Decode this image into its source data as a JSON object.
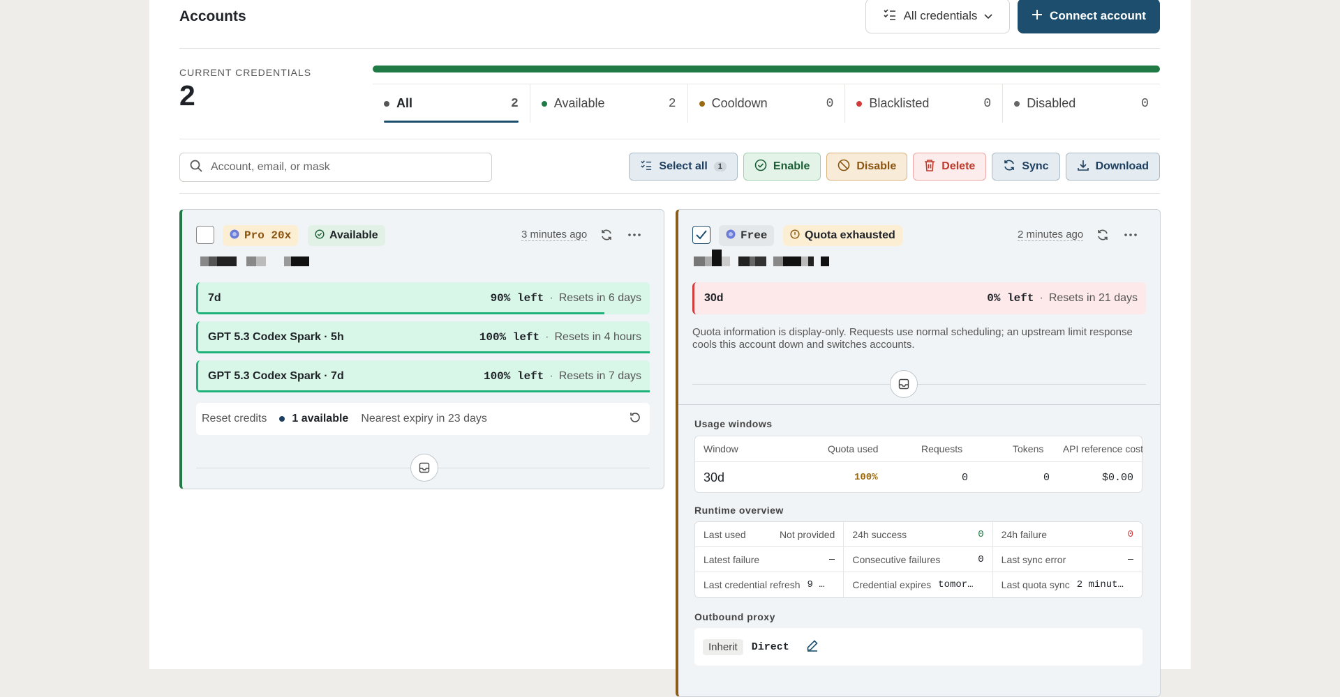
{
  "header": {
    "title": "Accounts",
    "credentials_filter": "All credentials",
    "connect_button": "Connect account"
  },
  "summary": {
    "label": "CURRENT CREDENTIALS",
    "count": "2",
    "tabs": [
      {
        "label": "All",
        "count": "2",
        "color": "#555555"
      },
      {
        "label": "Available",
        "count": "2",
        "color": "#1f7a45"
      },
      {
        "label": "Cooldown",
        "count": "0",
        "color": "#9a6a12"
      },
      {
        "label": "Blacklisted",
        "count": "0",
        "color": "#d33a3a"
      },
      {
        "label": "Disabled",
        "count": "0",
        "color": "#666666"
      }
    ]
  },
  "toolbar": {
    "search_placeholder": "Account, email, or mask",
    "select_all": "Select all",
    "selected_count": "1",
    "enable": "Enable",
    "disable": "Disable",
    "delete": "Delete",
    "sync": "Sync",
    "download": "Download"
  },
  "card1": {
    "plan": "Pro 20x",
    "status": "Available",
    "time": "3 minutes ago",
    "quotas": [
      {
        "name": "7d",
        "left": "90% left",
        "reset": "Resets in 6 days",
        "fraction": 0.9
      },
      {
        "name": "GPT 5.3 Codex Spark · 5h",
        "left": "100% left",
        "reset": "Resets in 4 hours",
        "fraction": 1.0
      },
      {
        "name": "GPT 5.3 Codex Spark · 7d",
        "left": "100% left",
        "reset": "Resets in 7 days",
        "fraction": 1.0
      }
    ],
    "reset_credits_label": "Reset credits",
    "reset_available": "1 available",
    "nearest_expiry": "Nearest expiry in 23 days"
  },
  "card2": {
    "plan": "Free",
    "status": "Quota exhausted",
    "time": "2 minutes ago",
    "quota": {
      "name": "30d",
      "left": "0% left",
      "reset": "Resets in 21 days"
    },
    "note": "Quota information is display-only. Requests use normal scheduling; an upstream limit response cools this account down and switches accounts.",
    "usage_title": "Usage windows",
    "usage_headers": [
      "Window",
      "Quota used",
      "Requests",
      "Tokens",
      "API reference cost"
    ],
    "usage_row": {
      "window": "30d",
      "quota_used": "100%",
      "requests": "0",
      "tokens": "0",
      "cost": "$0.00"
    },
    "runtime_title": "Runtime overview",
    "runtime": [
      {
        "label": "Last used",
        "value": "Not provided"
      },
      {
        "label": "24h success",
        "value": "0"
      },
      {
        "label": "24h failure",
        "value": "0"
      },
      {
        "label": "Latest failure",
        "value": "—"
      },
      {
        "label": "Consecutive failures",
        "value": "0"
      },
      {
        "label": "Last sync error",
        "value": "—"
      },
      {
        "label": "Last credential refresh",
        "value": "9 …"
      },
      {
        "label": "Credential expires",
        "value": "tomor…"
      },
      {
        "label": "Last quota sync",
        "value": "2 minut…"
      }
    ],
    "proxy_title": "Outbound proxy",
    "proxy_inherit": "Inherit",
    "proxy_value": "Direct"
  }
}
